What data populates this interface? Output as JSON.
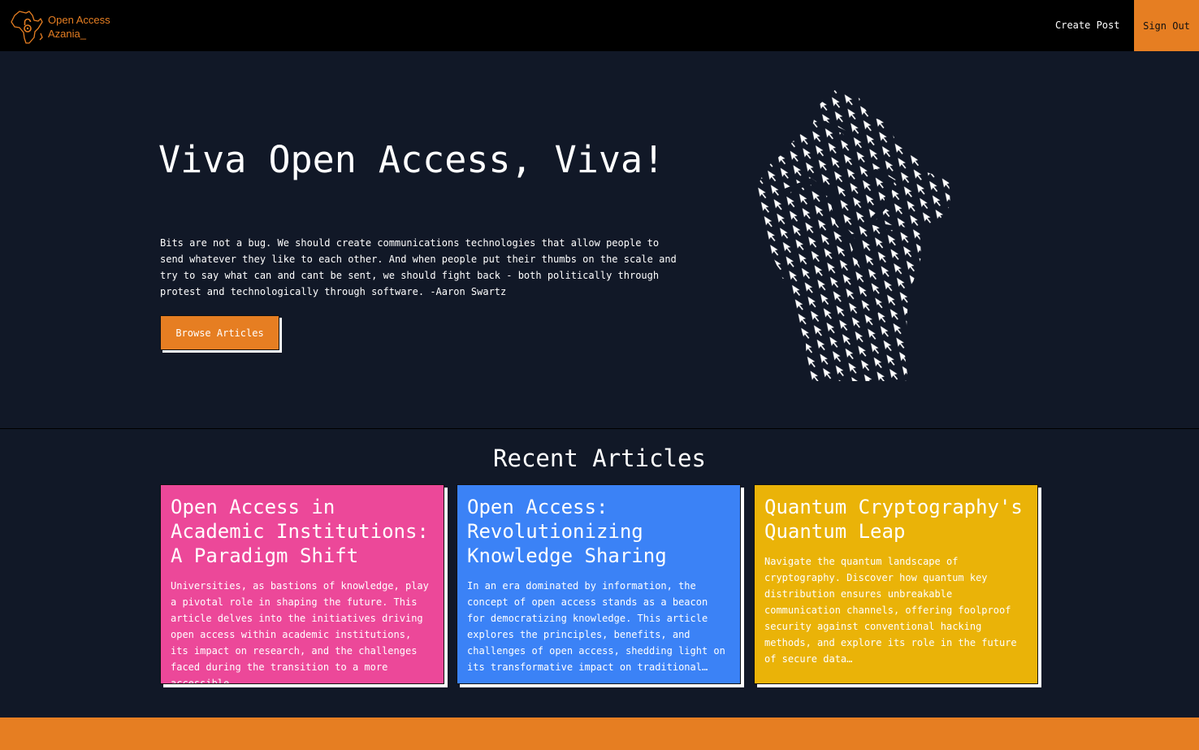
{
  "nav": {
    "brand_line1": "Open Access",
    "brand_line2": "Azania_",
    "create_post": "Create Post",
    "sign_out": "Sign Out"
  },
  "hero": {
    "title": "Viva Open Access, Viva!",
    "quote": "Bits are not a bug. We should create communications technologies that allow people to send whatever they like to each other. And when people put their thumbs on the scale and try to say what can and cant be sent, we should fight back - both politically through protest and technologically through software. -Aaron Swartz",
    "browse_button": "Browse Articles",
    "image_icon": "raised-fist-of-cursors-icon"
  },
  "recent": {
    "title": "Recent Articles",
    "articles": [
      {
        "title": "Open Access in Academic Institutions: A Paradigm Shift",
        "excerpt": "Universities, as bastions of knowledge, play a pivotal role in shaping the future. This article delves into the initiatives driving open access within academic institutions, its impact on research, and the challenges faced during the transition to a more accessible…",
        "color": "#ec4899"
      },
      {
        "title": "Open Access: Revolutionizing Knowledge Sharing",
        "excerpt": "In an era dominated by information, the concept of open access stands as a beacon for democratizing knowledge. This article explores the principles, benefits, and challenges of open access, shedding light on its transformative impact on traditional…",
        "color": "#3b82f6"
      },
      {
        "title": "Quantum Cryptography's Quantum Leap",
        "excerpt": "Navigate the quantum landscape of cryptography. Discover how quantum key distribution ensures unbreakable communication channels, offering foolproof security against conventional hacking methods, and explore its role in the future of secure data…",
        "color": "#eab308"
      }
    ]
  },
  "colors": {
    "accent": "#e67e22",
    "background": "#111827",
    "navbar": "#000000"
  }
}
